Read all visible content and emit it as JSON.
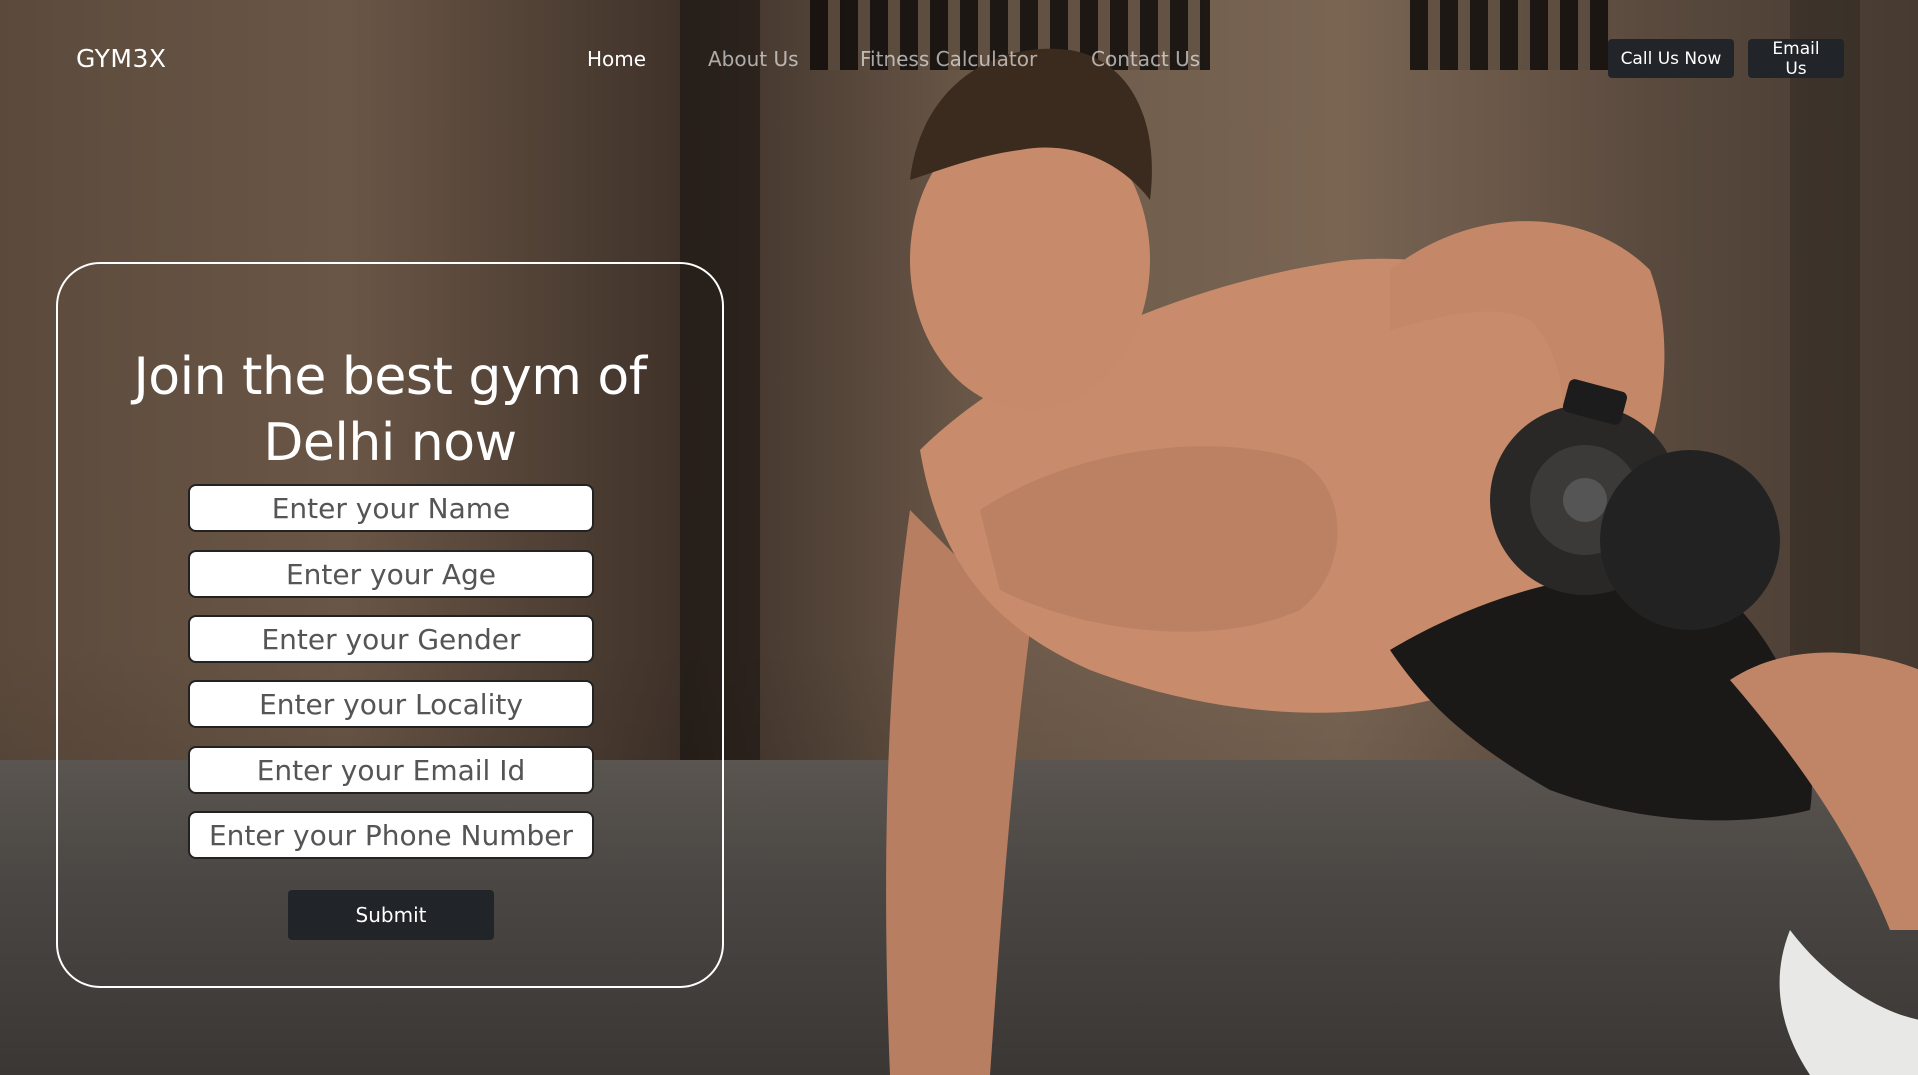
{
  "brand": "GYM3X",
  "nav": {
    "links": [
      "Home",
      "About Us",
      "Fitness Calculator",
      "Contact Us"
    ],
    "active": "Home",
    "buttons": {
      "call": "Call Us Now",
      "email": "Email Us"
    }
  },
  "form": {
    "title_line1": "Join the best gym of",
    "title_line2": "Delhi now",
    "fields": {
      "name": "Enter your Name",
      "age": "Enter your Age",
      "gender": "Enter your Gender",
      "locality": "Enter your Locality",
      "email": "Enter your Email Id",
      "phone": "Enter your Phone Number"
    },
    "submit_label": "Submit"
  },
  "colors": {
    "button_dark": "#212529",
    "nav_text": "#ffffff",
    "field_border": "#222222"
  }
}
